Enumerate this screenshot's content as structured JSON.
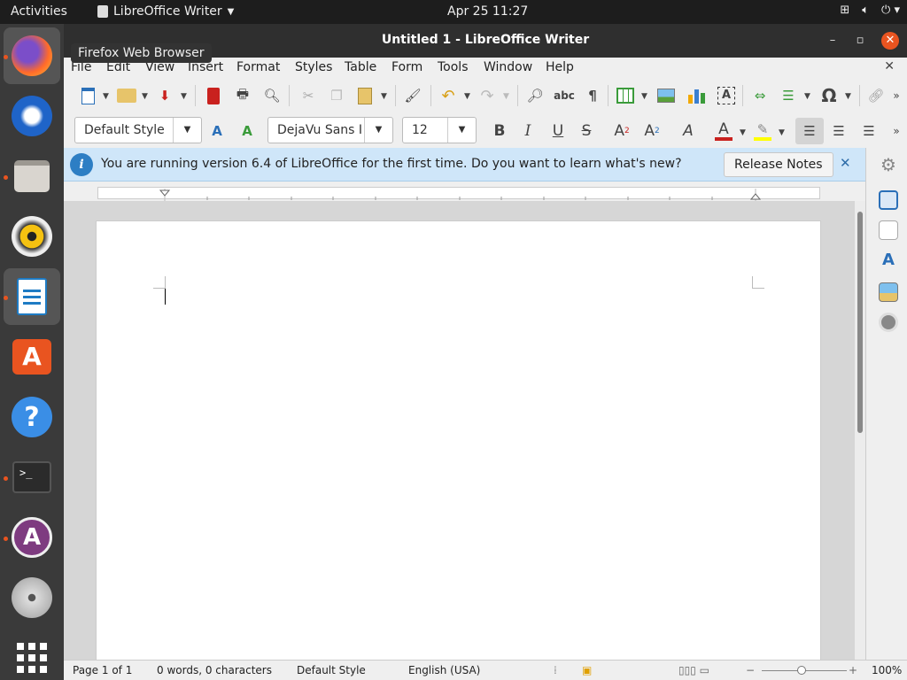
{
  "topbar": {
    "activities": "Activities",
    "app_menu": "LibreOffice Writer",
    "clock": "Apr 25  11:27",
    "tray_icons": [
      "network-icon",
      "volume-icon",
      "power-icon"
    ]
  },
  "dock": {
    "items": [
      {
        "name": "firefox",
        "active": true
      },
      {
        "name": "thunderbird"
      },
      {
        "name": "files"
      },
      {
        "name": "rhythmbox"
      },
      {
        "name": "libreoffice-writer",
        "active": true
      },
      {
        "name": "software"
      },
      {
        "name": "help"
      },
      {
        "name": "terminal"
      },
      {
        "name": "software-updater"
      },
      {
        "name": "dvd"
      },
      {
        "name": "show-apps"
      }
    ],
    "tooltip": "Firefox Web Browser"
  },
  "window": {
    "title": "Untitled 1 - LibreOffice Writer"
  },
  "menubar": {
    "items": [
      "File",
      "Edit",
      "View",
      "Insert",
      "Format",
      "Styles",
      "Table",
      "Form",
      "Tools",
      "Window",
      "Help"
    ]
  },
  "formatting": {
    "paragraph_style": "Default Style",
    "font_name": "DejaVu Sans I",
    "font_size": "12"
  },
  "infobar": {
    "message": "You are running version 6.4 of LibreOffice for the first time. Do you want to learn what's new?",
    "button": "Release Notes"
  },
  "statusbar": {
    "page": "Page 1 of 1",
    "words": "0 words, 0 characters",
    "style": "Default Style",
    "language": "English (USA)",
    "zoom": "100%"
  },
  "colors": {
    "accent": "#e95420",
    "infobar_bg": "#cfe6f9",
    "font_color": "#c9211e",
    "highlight": "#ffff00"
  }
}
